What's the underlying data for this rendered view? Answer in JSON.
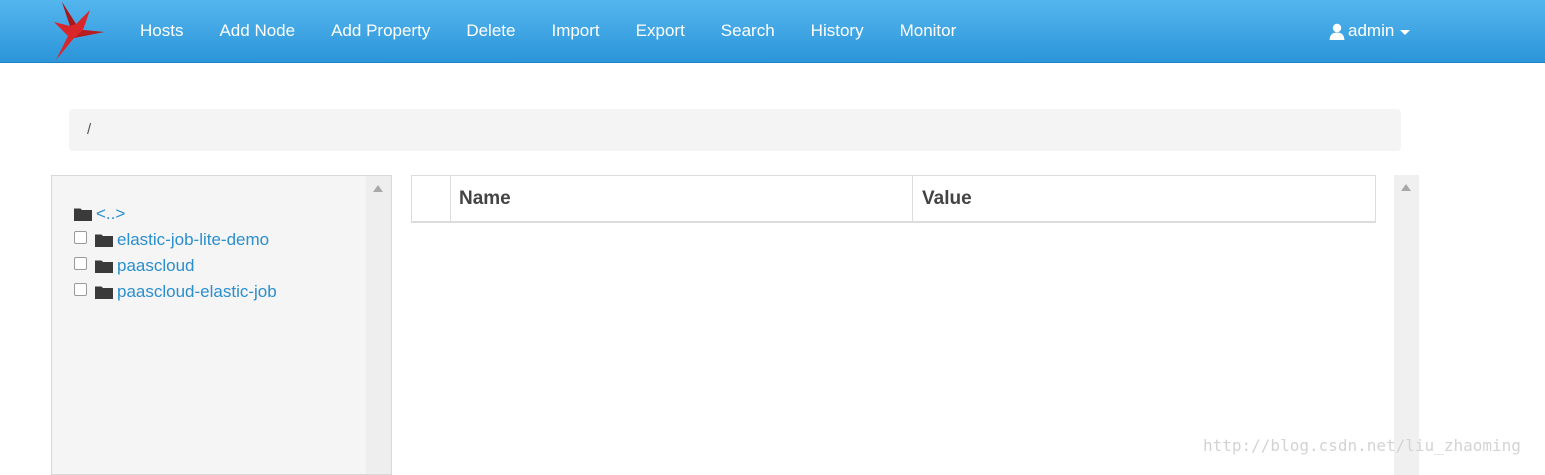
{
  "colors": {
    "navbar": "#3aa5e6",
    "link": "#2a8ecf",
    "brand": "#d9262a"
  },
  "brand": {
    "icon": "red-bird-logo"
  },
  "nav": {
    "items": [
      "Hosts",
      "Add Node",
      "Add Property",
      "Delete",
      "Import",
      "Export",
      "Search",
      "History",
      "Monitor"
    ],
    "user": {
      "label": "admin",
      "icon": "user-icon"
    }
  },
  "breadcrumb": {
    "path": "/"
  },
  "tree": {
    "parent_label": "<..>",
    "items": [
      {
        "label": "elastic-job-lite-demo",
        "checked": false
      },
      {
        "label": "paascloud",
        "checked": false
      },
      {
        "label": "paascloud-elastic-job",
        "checked": false
      }
    ]
  },
  "table": {
    "columns": [
      "Name",
      "Value"
    ],
    "rows": []
  },
  "watermark": "http://blog.csdn.net/liu_zhaoming"
}
